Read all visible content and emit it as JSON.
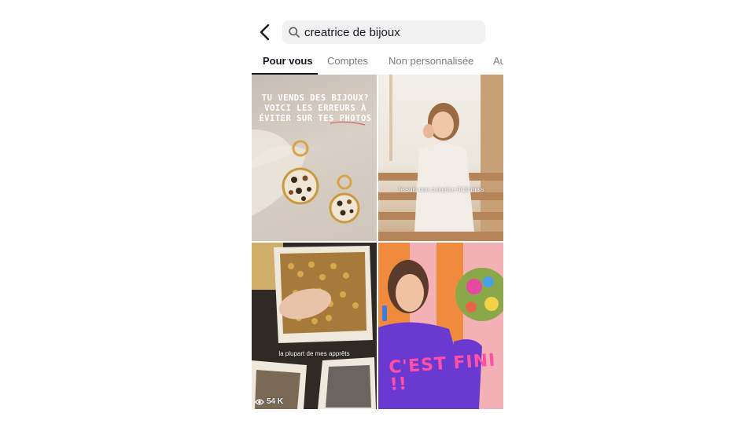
{
  "search": {
    "query": "creatrice de bijoux"
  },
  "tabs": [
    {
      "label": "Pour vous",
      "active": true
    },
    {
      "label": "Comptes",
      "active": false
    },
    {
      "label": "Non personnalisée",
      "active": false
    },
    {
      "label": "Au",
      "active": false
    }
  ],
  "results": [
    {
      "overlay_text": "TU VENDS DES BIJOUX? VOICI LES ERREURS À ÉVITER SUR TES PHOTOS"
    },
    {
      "caption": "Je suis une créatrice 0/10 mais"
    },
    {
      "caption": "la plupart de mes apprêts",
      "views": "54 K"
    },
    {
      "shirt_text": "C'EST FINI !!"
    }
  ],
  "colors": {
    "text_primary": "#161823",
    "text_secondary": "#7a7b80",
    "search_bg": "#f1f1f2",
    "shirt_pink": "#ff4fa6"
  }
}
